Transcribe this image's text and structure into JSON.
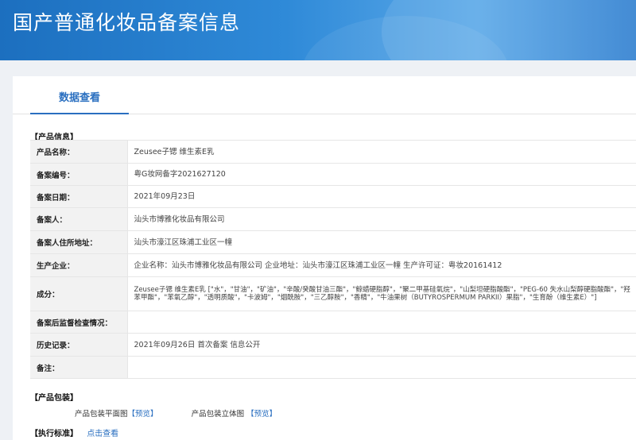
{
  "header": {
    "title": "国产普通化妆品备案信息"
  },
  "tab": {
    "label": "数据查看"
  },
  "product_info": {
    "section_title": "【产品信息】",
    "rows": [
      {
        "key": "产品名称：",
        "value": " Zeusee子锶 维生素E乳"
      },
      {
        "key": "备案编号：",
        "value": "粤G妆网备字2021627120"
      },
      {
        "key": "备案日期：",
        "value": "2021年09月23日"
      },
      {
        "key": "备案人：",
        "value": "汕头市博雅化妆品有限公司"
      },
      {
        "key": "备案人住所地址：",
        "value": "汕头市濠江区珠浦工业区一幢"
      },
      {
        "key": "生产企业：",
        "value": "企业名称：汕头市博雅化妆品有限公司 企业地址：汕头市濠江区珠浦工业区一幢 生产许可证：粤妆20161412"
      },
      {
        "key": "成分：",
        "value": "Zeusee子锶 维生素E乳 [\"水\"，\"甘油\"，\"矿油\"，\"辛酸/癸酸甘油三酯\"，\"鲸蜡硬脂醇\"，\"聚二甲基硅氧烷\"，\"山梨坦硬脂酸酯\"，\"PEG-60 失水山梨醇硬脂酸酯\"，\"羟苯甲酯\"，\"苯氧乙醇\"，\"透明质酸\"，\"卡波姆\"，\"烟酰胺\"，\"三乙醇胺\"，\"香精\"，\"牛油果树（BUTYROSPERMUM PARKII）果脂\"，\"生育酚（维生素E）\"]"
      },
      {
        "key": "备案后监督检查情况：",
        "value": ""
      },
      {
        "key": "历史记录：",
        "value": "2021年09月26日 首次备案 信息公开"
      },
      {
        "key": "备注：",
        "value": ""
      }
    ]
  },
  "packaging": {
    "section_title": "【产品包装】",
    "flat_label": "产品包装平面图",
    "flat_link": "【预览】",
    "solid_label": "产品包装立体图",
    "solid_link": "【预览】"
  },
  "standard": {
    "section_title": "【执行标准】",
    "link": "点击查看"
  }
}
